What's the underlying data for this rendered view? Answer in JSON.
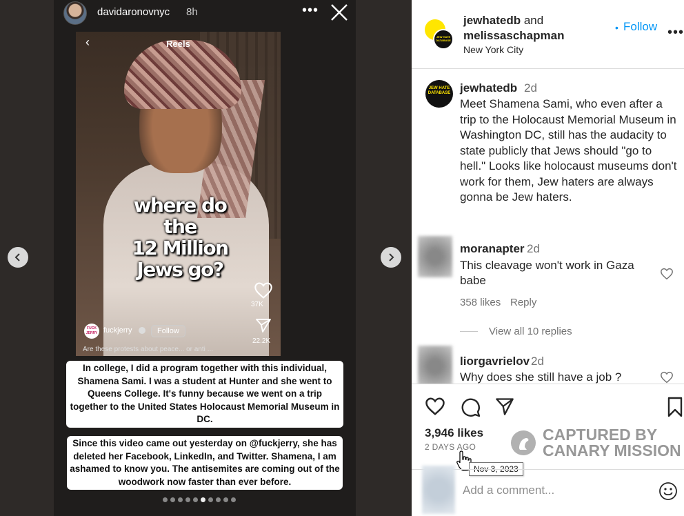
{
  "story": {
    "username": "davidaronovnyc",
    "time": "8h",
    "more_label": "•••",
    "reel": {
      "header_title": "Reels",
      "caption_lines": [
        "where do the",
        "12 Million",
        "Jews go?"
      ],
      "like_count": "37K",
      "share_count": "22.2K",
      "account_avatar_text": "FUCK JERRY",
      "account_name": "fuckjerry",
      "follow_label": "Follow",
      "description": "Are these protests about peace... or anti ..."
    },
    "textbox_1": "In college, I did a program together with this individual, Shamena Sami. I was a student at Hunter and she went to Queens College. It's funny because we went on a trip together to the United States Holocaust Memorial Museum in DC.",
    "textbox_2": "Since this video came out yesterday on @fuckjerry, she has deleted her Facebook, LinkedIn, and Twitter. Shamena, I am ashamed to know you. The antisemites are coming out of the woodwork now faster than ever before.",
    "dots_total": 10,
    "dots_active_index": 5
  },
  "post": {
    "collab_user_1": "jewhatedb",
    "collab_and": " and",
    "collab_user_2": "melissaschapman",
    "location": "New York City",
    "follow_dot": "•",
    "follow_label": "Follow",
    "more_label": "•••",
    "avatar_text": "JEW HATE DATABASE",
    "caption": {
      "username": "jewhatedb",
      "time": "2d",
      "text": "Meet Shamena Sami, who even after a trip to the Holocaust Memorial Museum in Washington DC, still has the audacity to state publicly that Jews should \"go to hell.\" Looks like holocaust museums don't work for them, Jew haters are always gonna be Jew haters."
    },
    "comments": [
      {
        "username": "moranapter",
        "time": "2d",
        "text": "This cleavage won't work in Gaza babe",
        "likes": "358 likes",
        "reply_label": "Reply"
      },
      {
        "username": "liorgavrielov",
        "time": "2d",
        "text": "Why does she still have a job ?"
      }
    ],
    "view_replies": "View all 10 replies",
    "likes": "3,946 likes",
    "age": "2 DAYS AGO",
    "tooltip_date": "Nov 3, 2023",
    "comment_placeholder": "Add a comment..."
  },
  "watermark": {
    "line1": "CAPTURED BY",
    "line2": "CANARY MISSION"
  },
  "colors": {
    "link_blue": "#0095f6",
    "story_bg": "#2e2a28",
    "text_dark": "#262626",
    "muted": "#737373"
  }
}
